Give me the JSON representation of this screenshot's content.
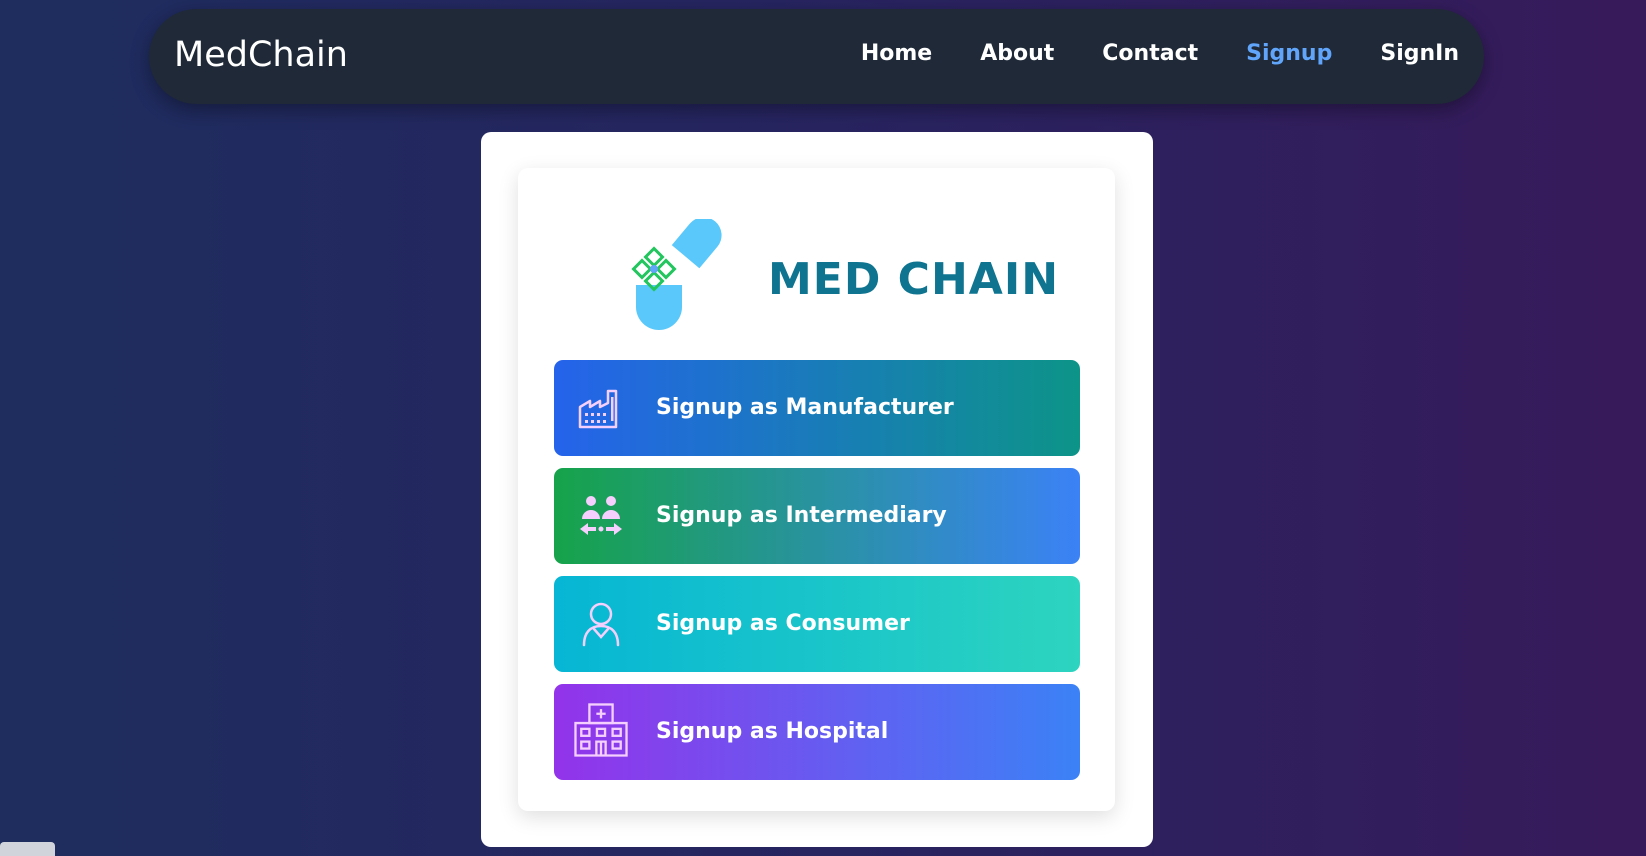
{
  "navbar": {
    "brand": "MedChain",
    "links": [
      {
        "label": "Home"
      },
      {
        "label": "About"
      },
      {
        "label": "Contact"
      },
      {
        "label": "Signup",
        "active": true
      },
      {
        "label": "SignIn"
      }
    ]
  },
  "card": {
    "logo_text": "MED CHAIN",
    "logo_icon": "pill-capsule-icon",
    "buttons": [
      {
        "label": "Signup as Manufacturer",
        "icon": "factory-icon"
      },
      {
        "label": "Signup as Intermediary",
        "icon": "people-exchange-icon"
      },
      {
        "label": "Signup as Consumer",
        "icon": "user-icon"
      },
      {
        "label": "Signup as Hospital",
        "icon": "hospital-icon"
      }
    ]
  },
  "colors": {
    "navbar_bg": "#1f2937",
    "active_link": "#60a5fa",
    "logo_text": "#0e7490",
    "capsule": "#5ac8fa",
    "icon_tint": "#f5d0fe"
  }
}
